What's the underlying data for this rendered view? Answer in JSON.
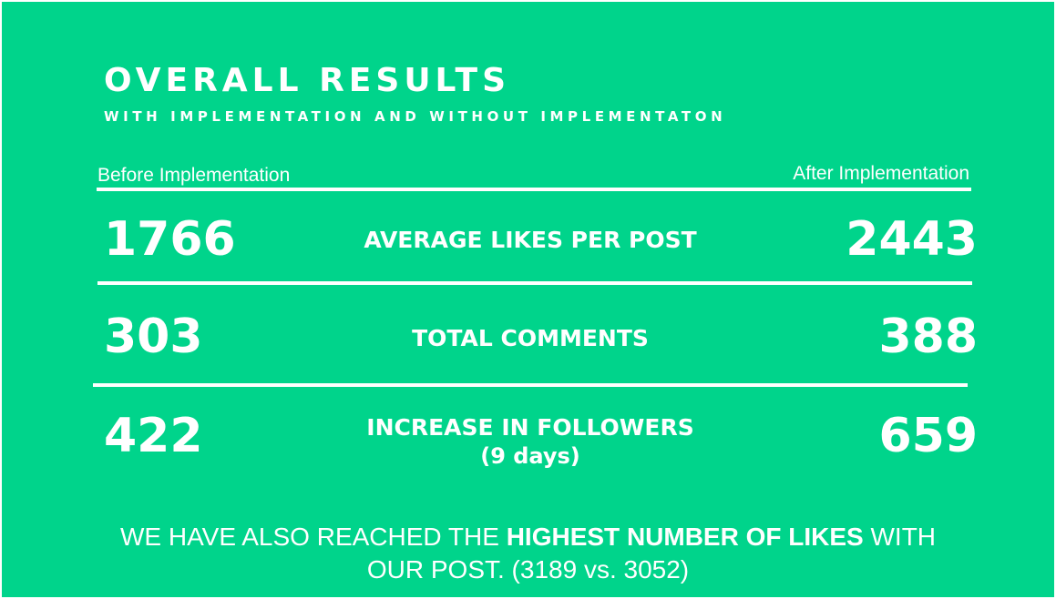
{
  "header": {
    "title": "OVERALL RESULTS",
    "subtitle": "WITH IMPLEMENTATION AND WITHOUT IMPLEMENTATON"
  },
  "columns": {
    "before": "Before Implementation",
    "after": "After Implementation"
  },
  "rows": [
    {
      "metric": "AVERAGE LIKES PER POST",
      "before": "1766",
      "after": "2443"
    },
    {
      "metric": "TOTAL COMMENTS",
      "before": "303",
      "after": "388"
    },
    {
      "metric": "INCREASE IN FOLLOWERS",
      "metric_note": "(9 days)",
      "before": "422",
      "after": "659"
    }
  ],
  "footer": {
    "part1": "WE HAVE ALSO REACHED THE ",
    "highlight": "HIGHEST NUMBER OF LIKES",
    "part2": " WITH",
    "line2": "OUR POST. (3189 vs. 3052)"
  },
  "colors": {
    "background": "#00d48b",
    "text": "#ffffff"
  }
}
